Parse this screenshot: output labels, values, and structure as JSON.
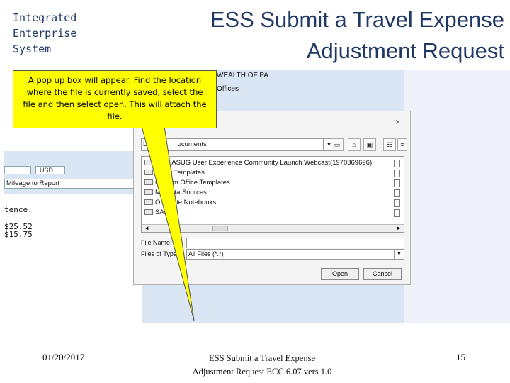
{
  "brand": {
    "line1": "Integrated",
    "line2": "Enterprise",
    "line3": "System"
  },
  "slide": {
    "title_line1": "ESS Submit a Travel Expense",
    "title_line2": "Adjustment Request"
  },
  "callout": {
    "text": "A pop up box will appear.  Find the location where the file is currently saved, select the file and then select open.  This will attach the file."
  },
  "background_app": {
    "wealth": "WEALTH OF PA",
    "offices": "Offices",
    "currency": "USD",
    "mileage": "Mileage to Report",
    "tence": "tence.",
    "amount1": "$25.52",
    "amount2": "$15.75"
  },
  "dialog": {
    "close": "×",
    "look_in_label": "Lo",
    "look_in_value": "ocuments",
    "files": [
      "2016 ASUG User Experience Community Launch Webcast(1970369696)",
      "Avery Templates",
      "Custom Office Templates",
      "My Data Sources",
      "OneNote Notebooks",
      "SAP"
    ],
    "file_name_label": "File Name:",
    "file_name_value": "",
    "files_of_type_label": "Files of Type:",
    "files_of_type_value": "All Files (*.*)",
    "open_label": "Open",
    "cancel_label": "Cancel"
  },
  "footer": {
    "date": "01/20/2017",
    "title_line1": "ESS Submit a Travel Expense",
    "title_line2": "Adjustment Request ECC 6.07 vers 1.0",
    "page": "15"
  }
}
